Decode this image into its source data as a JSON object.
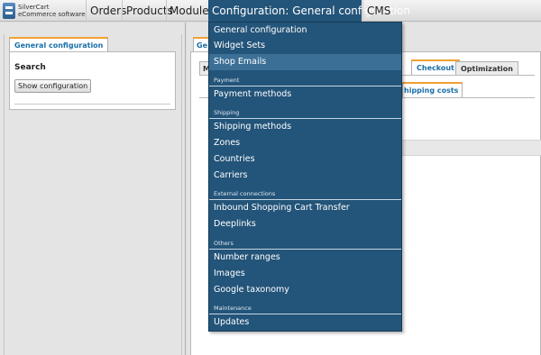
{
  "brand": {
    "line1": "SilverCart",
    "line2": "eCommerce software"
  },
  "topmenu": {
    "orders": "Orders",
    "products": "Products",
    "modules": "Modules",
    "configuration": "Configuration: General configuration",
    "cms": "CMS"
  },
  "left_panel": {
    "tab": "General configuration",
    "search_title": "Search",
    "show_button": "Show configuration"
  },
  "main": {
    "tab_partial": "Ge",
    "tab_small": "M",
    "tab_checkout": "Checkout",
    "tab_optimization": "Optimization",
    "subtab_shipping": "hipping costs"
  },
  "dropdown": {
    "general": "General configuration",
    "widget_sets": "Widget Sets",
    "shop_emails": "Shop Emails",
    "payment_header": "Payment",
    "payment_methods": "Payment methods",
    "shipping_header": "Shipping",
    "shipping_methods": "Shipping methods",
    "zones": "Zones",
    "countries": "Countries",
    "carriers": "Carriers",
    "external_header": "External connections",
    "inbound": "Inbound Shopping Cart Transfer",
    "deeplinks": "Deeplinks",
    "others_header": "Others",
    "number_ranges": "Number ranges",
    "images": "Images",
    "google_taxonomy": "Google taxonomy",
    "maintenance_header": "Maintenance",
    "updates": "Updates"
  },
  "colors": {
    "menu_blue": "#235479",
    "hover_blue": "#3b6f96",
    "tab_accent": "#f0a030",
    "tab_text": "#1a6fa8"
  }
}
